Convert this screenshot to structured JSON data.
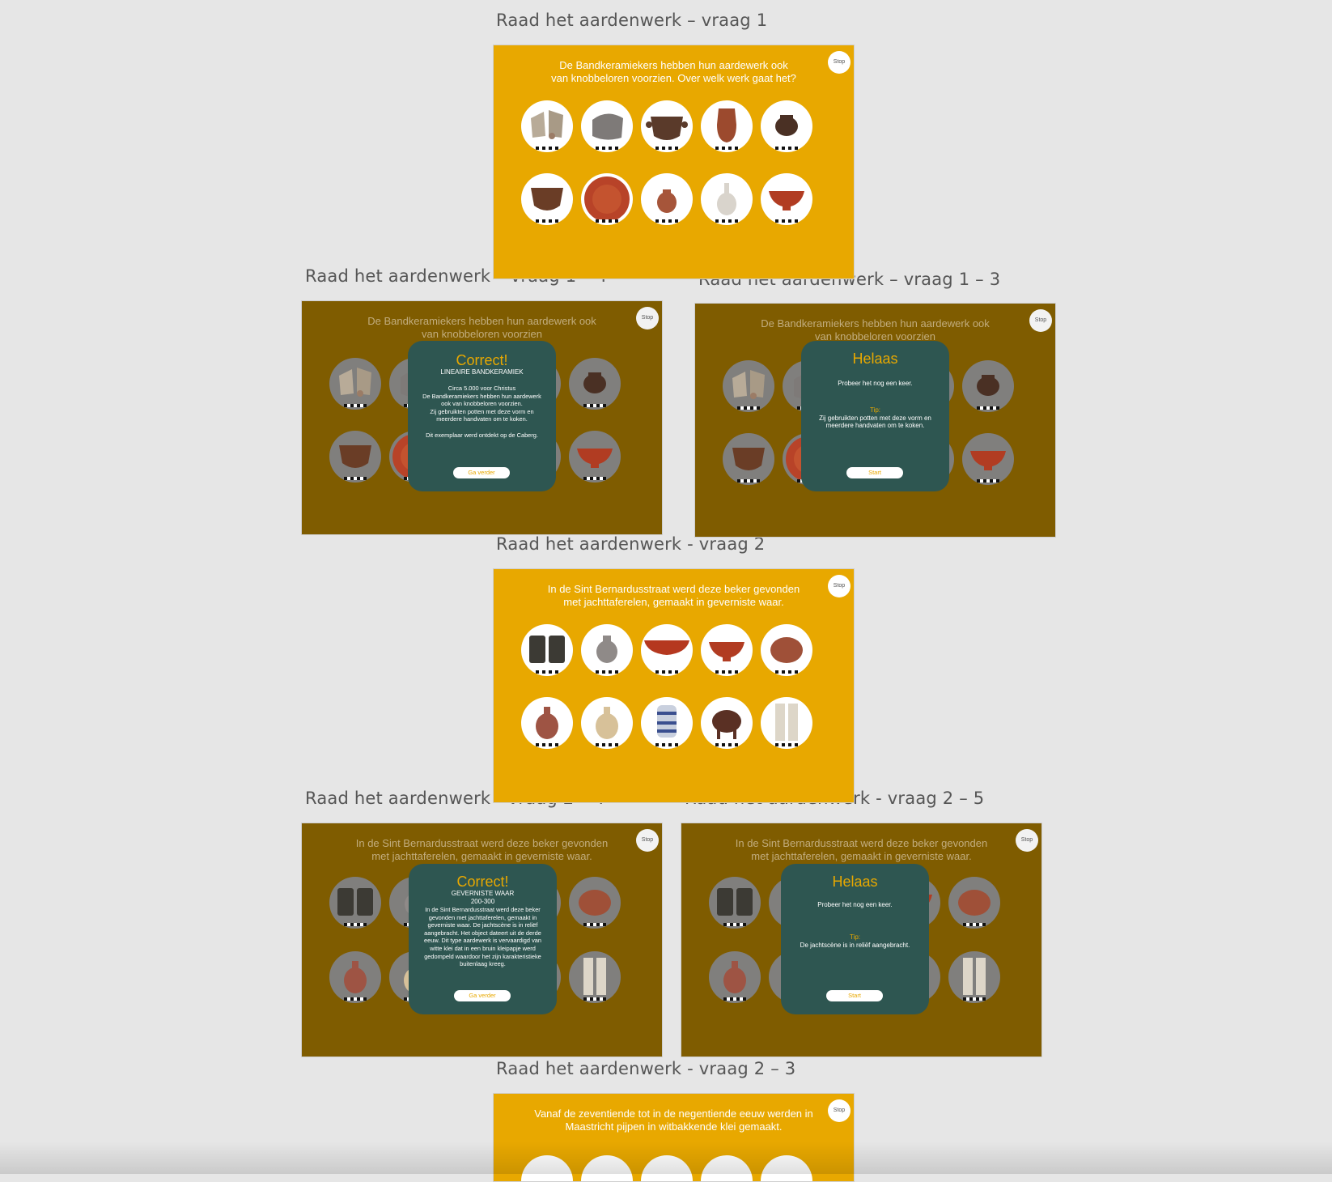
{
  "labels": {
    "a1": "Raad het aardenwerk – vraag 1",
    "a2": "Raad het aardenwerk – vraag 1 – 4",
    "a3": "Raad het aardenwerk – vraag 1 – 3",
    "a4": "Raad het aardenwerk - vraag 2",
    "a5": "Raad het aardenwerk - vraag 2 – 4",
    "a6": "Raad het aardenwerk - vraag 2 – 5",
    "a7": "Raad het aardenwerk - vraag 2 – 3"
  },
  "stop_label": "Stop",
  "q1": {
    "question": "De Bandkeramiekers hebben hun aardewerk ook\nvan knobbeloren voorzien. Over welk werk gaat het?",
    "question_short": "De Bandkeramiekers hebben hun aardewerk ook\nvan knobbeloren voorzien"
  },
  "q2": {
    "question": "In de Sint Bernardusstraat werd deze beker gevonden\nmet jachttaferelen, gemaakt in geverniste waar."
  },
  "q3": {
    "question": "Vanaf de zeventiende tot in de negentiende eeuw werden in\nMaastricht pijpen in witbakkende klei gemaakt."
  },
  "correct1": {
    "title": "Correct!",
    "subtitle": "LINEAIRE BANDKERAMIEK",
    "body": "Circa 5.000 voor Christus\nDe Bandkeramiekers hebben hun aardewerk\nook van knobbeloren voorzien.\nZij gebruikten potten met deze vorm en\nmeerdere handvaten om te koken.\n\nDit exemplaar werd ontdekt op de Caberg.",
    "button": "Ga verder"
  },
  "helaas1": {
    "title": "Helaas",
    "text": "Probeer het nog een keer.",
    "tip_label": "Tip:",
    "tip": "Zij gebruikten potten met deze vorm en meerdere handvaten om te koken.",
    "button": "Start"
  },
  "correct2": {
    "title": "Correct!",
    "subtitle": "GEVERNISTE WAAR",
    "date": "200-300",
    "body": "In de Sint Bernardusstraat werd deze beker gevonden met jachttaferelen, gemaakt in geverniste waar. De jachtscène is in reliëf aangebracht. Het object dateert uit de derde eeuw. Dit type aardewerk is vervaardigd van witte klei dat in een bruin kleipapje werd gedompeld waardoor het zijn karakteristieke buitenlaag kreeg.",
    "button": "Ga verder"
  },
  "helaas2": {
    "title": "Helaas",
    "text": "Probeer het nog een keer.",
    "tip_label": "Tip:",
    "tip": "De jachtscène is in reliëf aangebracht.",
    "button": "Start"
  },
  "pots_q1": [
    "shard-fragments",
    "grey-sherd",
    "dark-pot-lugs",
    "tall-red-beaker",
    "small-dark-pot",
    "brown-bowl-pot",
    "red-plate",
    "small-red-jar",
    "white-jug",
    "red-bowl"
  ],
  "pots_q2": [
    "dark-hunt-beaker",
    "grey-jar",
    "red-flat-bowl",
    "red-bowl",
    "red-globular-pot",
    "red-two-handled-jar",
    "cream-painted-jar",
    "blue-striped-albarello",
    "dark-tripod-pot",
    "white-pipe-fragments"
  ],
  "colors": {
    "accent": "#e8a800",
    "dimmed": "#7f5c00",
    "modal": "#2e5651"
  }
}
